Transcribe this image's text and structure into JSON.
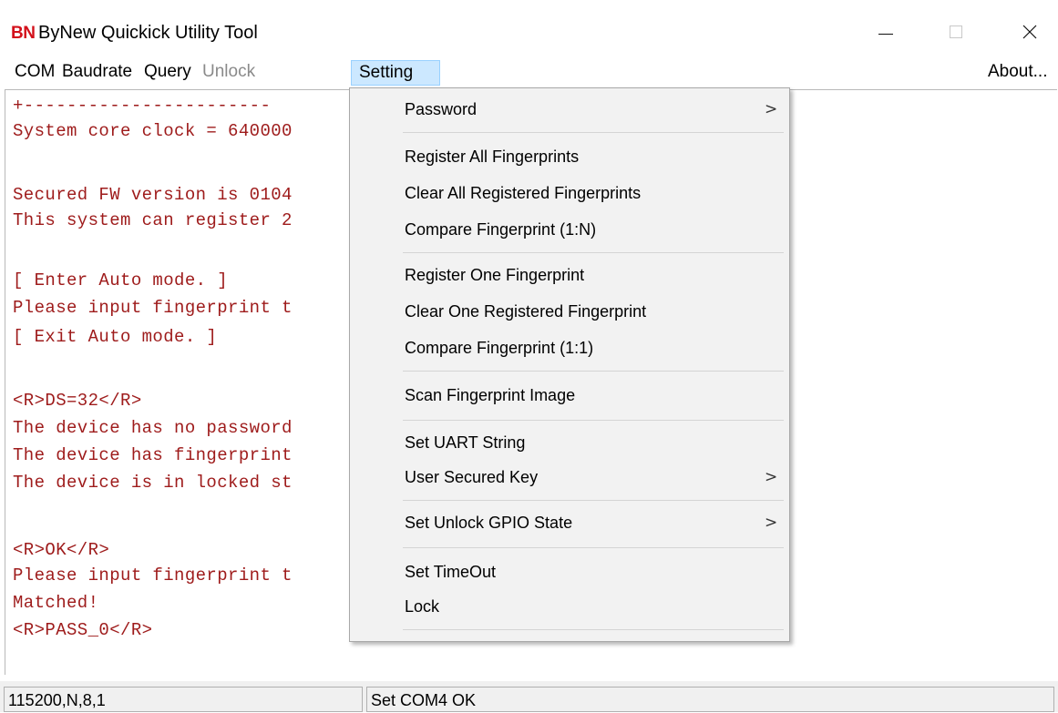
{
  "window": {
    "logo": "BN",
    "title": "ByNew Quickick Utility Tool",
    "minimize_icon": "minimize-icon",
    "maximize_icon": "maximize-icon",
    "close_icon": "close-icon"
  },
  "menubar": {
    "items": [
      {
        "label": "COM",
        "enabled": true
      },
      {
        "label": "Baudrate",
        "enabled": true
      },
      {
        "label": "Query",
        "enabled": true
      },
      {
        "label": "Unlock",
        "enabled": false
      },
      {
        "label": "Setting",
        "enabled": true,
        "active": true
      }
    ],
    "about": "About..."
  },
  "console": {
    "text_color": "#9e1b1b",
    "lines": [
      "+-----------------------",
      "System core clock = 640000",
      "",
      "Secured FW version is 0104",
      "This system can register 2",
      "",
      "[ Enter Auto mode. ]",
      "Please input fingerprint t",
      "[ Exit Auto mode. ]",
      "",
      "<R>DS=32</R>",
      "The device has no password",
      "The device has fingerprint",
      "The device is in locked st",
      "",
      "<R>OK</R>",
      "Please input fingerprint t",
      "Matched!",
      "<R>PASS_0</R>"
    ]
  },
  "setting_menu": {
    "items": [
      {
        "label": "Password",
        "submenu": true
      },
      {
        "label": "Register All Fingerprints",
        "submenu": false
      },
      {
        "label": "Clear All Registered Fingerprints",
        "submenu": false
      },
      {
        "label": "Compare Fingerprint (1:N)",
        "submenu": false
      },
      {
        "label": "Register One Fingerprint",
        "submenu": false
      },
      {
        "label": "Clear One Registered Fingerprint",
        "submenu": false
      },
      {
        "label": "Compare Fingerprint (1:1)",
        "submenu": false
      },
      {
        "label": "Scan Fingerprint Image",
        "submenu": false
      },
      {
        "label": "Set UART String",
        "submenu": false
      },
      {
        "label": "User Secured Key",
        "submenu": true
      },
      {
        "label": "Set Unlock GPIO State",
        "submenu": true
      },
      {
        "label": "Set TimeOut",
        "submenu": false
      },
      {
        "label": "Lock",
        "submenu": false
      }
    ],
    "submenu_arrow": ">"
  },
  "statusbar": {
    "left": "115200,N,8,1",
    "right": "Set COM4 OK"
  },
  "colors": {
    "logo": "#d3111b",
    "menu_highlight": "#cce8ff",
    "menu_background": "#f2f2f2"
  }
}
